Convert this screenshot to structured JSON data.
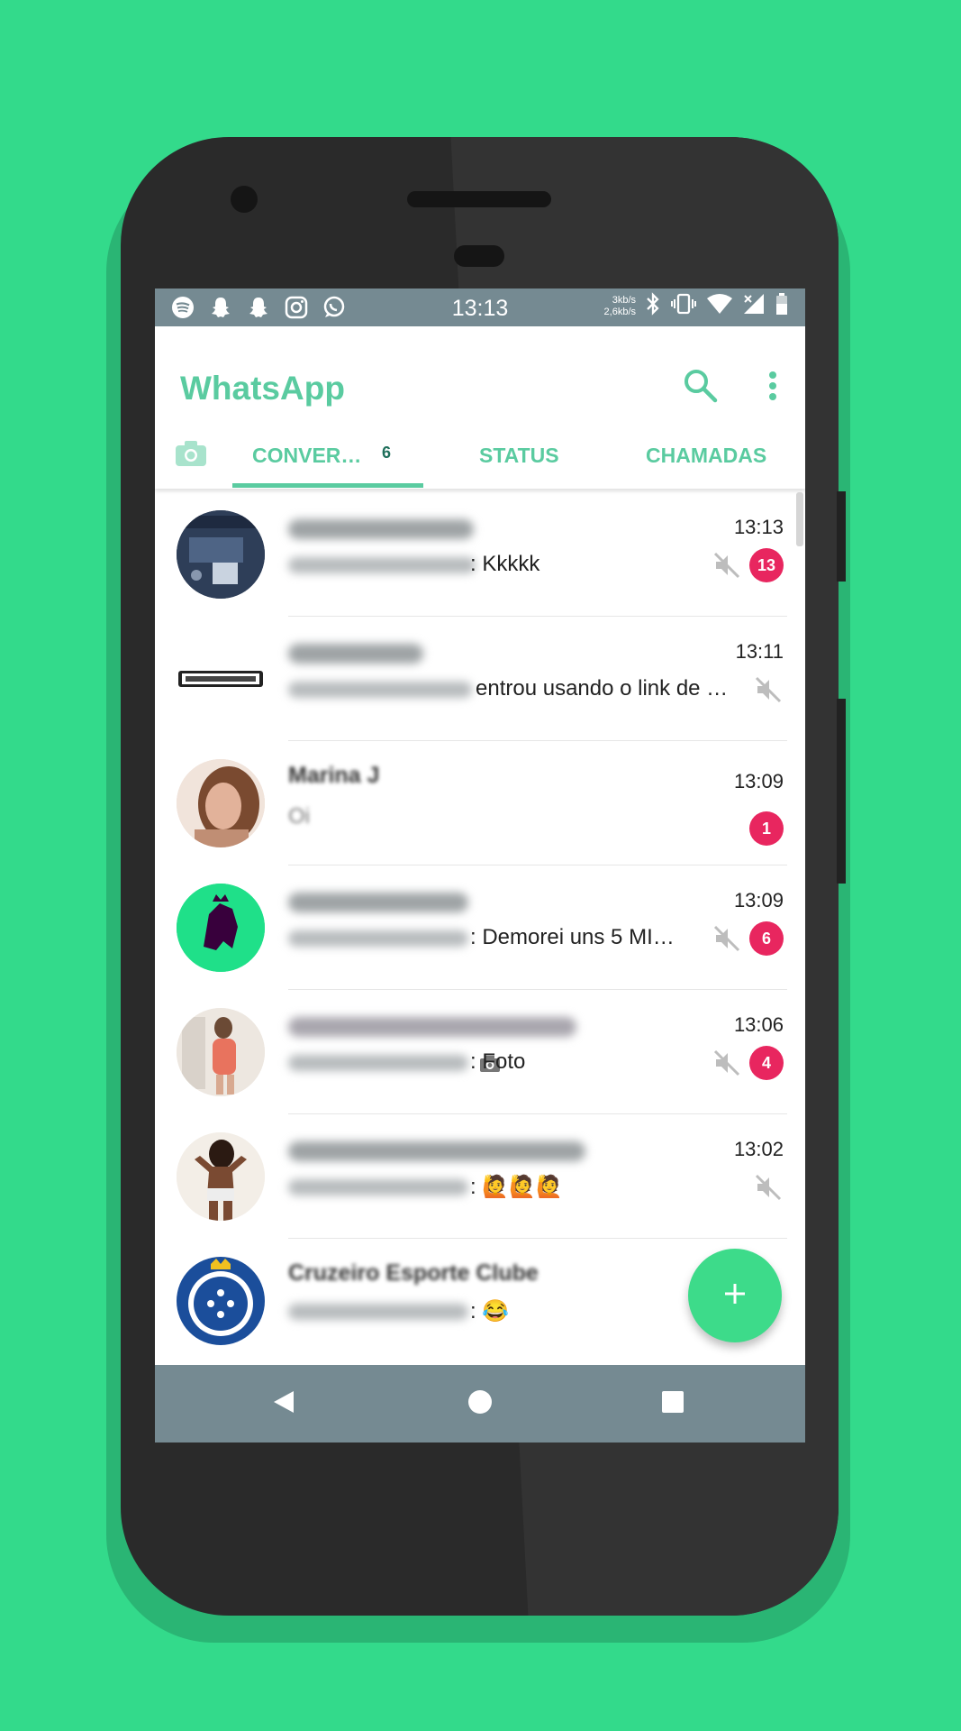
{
  "colors": {
    "background": "#33DA8B",
    "accent": "#5ACBA0",
    "badge": "#E8265F",
    "bars": "#758A92",
    "fab": "#3DDB8A"
  },
  "status_bar": {
    "time": "13:13",
    "speed_up": "3kb/s",
    "speed_down": "2,6kb/s",
    "left_icons": [
      "spotify-icon",
      "snapchat-icon",
      "snapchat-icon",
      "instagram-icon",
      "whatsapp-icon"
    ],
    "right_icons": [
      "bluetooth-icon",
      "vibrate-icon",
      "wifi-icon",
      "signal-icon",
      "battery-icon"
    ]
  },
  "app": {
    "title": "WhatsApp"
  },
  "tabs": {
    "camera_icon": "camera-icon",
    "conversations": "CONVER…",
    "conversations_badge": "6",
    "status": "STATUS",
    "calls": "CHAMADAS",
    "active": "conversations"
  },
  "chats": [
    {
      "time": "13:13",
      "message": ": Kkkkk",
      "muted": true,
      "unread": "13"
    },
    {
      "time": "13:11",
      "message": "entrou usando o link de …",
      "muted": true,
      "unread": ""
    },
    {
      "name": "Marina J",
      "time": "13:09",
      "message": "Oi",
      "muted": false,
      "unread": "1"
    },
    {
      "time": "13:09",
      "message": ": Demorei uns 5 MI…",
      "muted": true,
      "unread": "6"
    },
    {
      "time": "13:06",
      "message": ": Foto",
      "muted": true,
      "unread": "4"
    },
    {
      "time": "13:02",
      "message": ": 🙋🙋🙋",
      "muted": true,
      "unread": ""
    },
    {
      "name": "Cruzeiro Esporte Clube",
      "time": "",
      "message": ": 😂",
      "muted": true,
      "unread": ""
    }
  ],
  "fab": {
    "icon": "plus-icon"
  },
  "nav": {
    "back": "back-icon",
    "home": "home-icon",
    "recents": "recents-icon"
  }
}
